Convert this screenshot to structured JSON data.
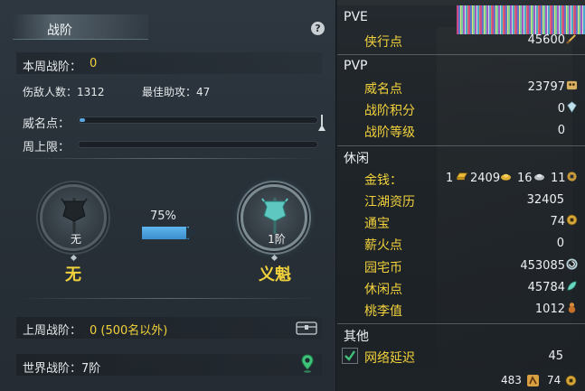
{
  "left": {
    "title": "战阶",
    "help": "?",
    "weekly_rank_label": "本周战阶：",
    "weekly_rank_value": "0",
    "kills_text": "伤敌人数：1312",
    "assists_text": "最佳助攻：47",
    "fame_label": "威名点：",
    "fame_progress": 0.02,
    "weekly_cap_label": "周上限：",
    "weekly_cap_progress": 0,
    "current_rank_level": "无",
    "current_rank_name": "无",
    "progress_percent": "75%",
    "next_rank_level": "1阶",
    "next_rank_name": "义魁",
    "last_week_label": "上周战阶：",
    "last_week_value": "0 (500名以外)",
    "world_rank_text": "世界战阶：7阶"
  },
  "right": {
    "pve": {
      "title": "PVE",
      "items": [
        {
          "label": "侠行点",
          "value": "45600",
          "icon": "sword-icon"
        }
      ]
    },
    "pvp": {
      "title": "PVP",
      "items": [
        {
          "label": "威名点",
          "value": "23797",
          "icon": "mask-icon"
        },
        {
          "label": "战阶积分",
          "value": "0",
          "icon": "crystal-icon"
        },
        {
          "label": "战阶等级",
          "value": "0"
        }
      ]
    },
    "leisure": {
      "title": "休闲",
      "money_label": "金钱：",
      "money": {
        "gold_bar": "1",
        "gold": "2409",
        "silver": "16",
        "copper": "11"
      },
      "items": [
        {
          "label": "江湖资历",
          "value": "32405"
        },
        {
          "label": "通宝",
          "value": "74",
          "icon": "coin-icon"
        },
        {
          "label": "薪火点",
          "value": "0"
        },
        {
          "label": "园宅币",
          "value": "453085",
          "icon": "swirl-coin-icon"
        },
        {
          "label": "休闲点",
          "value": "45784",
          "icon": "leaf-icon"
        },
        {
          "label": "桃李值",
          "value": "1012",
          "icon": "gourd-icon"
        }
      ]
    },
    "other": {
      "title": "其他",
      "latency_label": "网络延迟",
      "latency_value": "45",
      "latency_checked": true
    },
    "footer": {
      "value_a": "483",
      "value_b": "74"
    }
  },
  "colors": {
    "accent_yellow": "#f2d23c",
    "progress_blue": "#5aa8e0"
  }
}
